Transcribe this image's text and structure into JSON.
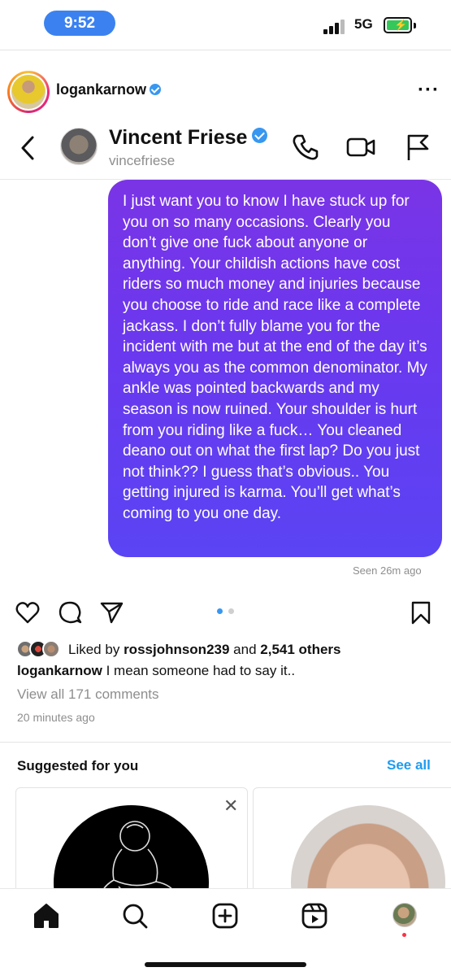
{
  "status_bar": {
    "time": "9:52",
    "network": "5G",
    "battery_state": "charging",
    "battery_level": 1.0,
    "signal_bars": 4
  },
  "post": {
    "username": "logankarnow",
    "verified": true,
    "more_icon": "more-horizontal-icon"
  },
  "dm": {
    "name": "Vincent Friese",
    "handle": "vincefriese",
    "verified": true,
    "icons": [
      "back-chevron-icon",
      "phone-icon",
      "video-camera-icon",
      "flag-icon"
    ],
    "message": "I just want you to know I have stuck up for you on so many occasions. Clearly you don’t give one fuck about anyone or anything. Your childish actions have cost riders so much money and injuries because you choose to ride and race like a complete jackass. I don’t fully blame you for the incident with me but at the end of the day it’s always you as the common denominator. My ankle was pointed backwards and my season is now ruined. Your shoulder is hurt from you riding like a fuck… You cleaned deano out on what the first lap? Do you just not think?? I guess that’s obvious.. You getting injured is karma. You’ll get what’s coming to you one day.",
    "seen": "Seen 26m ago",
    "bubble_gradient": [
      "#7a34e6",
      "#5a44f3"
    ]
  },
  "actions": {
    "icons": [
      "heart-icon",
      "comment-icon",
      "share-icon",
      "bookmark-icon"
    ],
    "carousel_active": 1,
    "carousel_total": 2,
    "active_dot_color": "#3897f0"
  },
  "likes": {
    "prefix": "Liked by",
    "user": "rossjohnson239",
    "connector": "and",
    "others": "2,541 others"
  },
  "caption": {
    "username": "logankarnow",
    "text": "I mean someone had to say it.."
  },
  "comments_link": "View all 171 comments",
  "timestamp": "20 minutes ago",
  "suggested": {
    "title": "Suggested for you",
    "see_all": "See all",
    "close_icon": "close-icon"
  },
  "bottom_nav": {
    "items": [
      "home-icon",
      "search-icon",
      "create-icon",
      "reels-icon",
      "profile-avatar"
    ]
  },
  "colors": {
    "accent": "#3897f0",
    "link": "#1d9bf0",
    "notification": "#ff3040"
  }
}
